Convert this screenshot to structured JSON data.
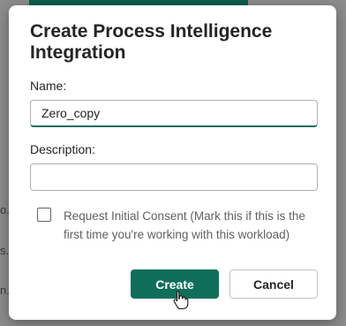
{
  "background": {
    "fragments": [
      "o.",
      "s.",
      "n."
    ],
    "accent": "#0d5e4e"
  },
  "dialog": {
    "title": "Create Process Intelligence Integration",
    "name_label": "Name:",
    "name_value": "Zero_copy",
    "description_label": "Description:",
    "description_value": "",
    "consent_label": "Request Initial Consent (Mark this if this is the first time you're working with this workload)",
    "consent_checked": false,
    "create_label": "Create",
    "cancel_label": "Cancel"
  },
  "colors": {
    "primary": "#0f6e5a",
    "text": "#242424",
    "muted_text": "#616161"
  },
  "icons": {
    "pointer": "hand-pointer-icon"
  }
}
